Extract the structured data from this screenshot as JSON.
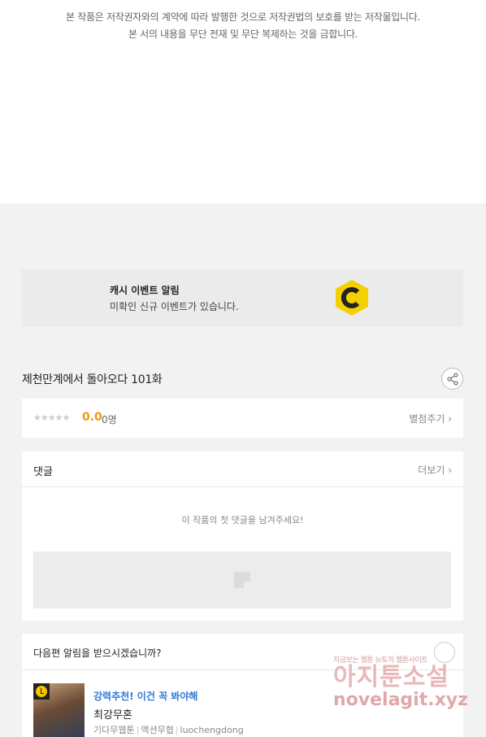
{
  "notice": {
    "line1": "본 작품은 저작권자와의 계약에 따라 발행한 것으로 저작권법의 보호를 받는 저작물입니다.",
    "line2": "본 서의 내용을 무단 전재 및 무단 복제하는 것을 금합니다."
  },
  "event": {
    "title": "캐시 이벤트 알림",
    "subtitle": "미확인 신규 이벤트가 있습니다.",
    "icon": "cash-c-icon",
    "icon_color": "#f5d000"
  },
  "episode": {
    "title": "제천만계에서 돌아오다 101화",
    "share_icon": "share-icon"
  },
  "rating": {
    "stars": "★★★★★",
    "score": "0.0",
    "count": "0명",
    "rate_link": "별점주기 ›"
  },
  "comments": {
    "title": "댓글",
    "more_link": "더보기 ›",
    "empty_message": "이 작품의 첫 댓글을 남겨주세요!"
  },
  "next_alert": {
    "title": "다음편 알림을 받으시겠습니까?",
    "bell_icon": "bell-icon"
  },
  "recommendation": {
    "tagline": "강력추천! 이건 꼭 봐야해",
    "title": "최강무혼",
    "meta": [
      "기다무웹툰",
      "액션무협",
      "luochengdong"
    ]
  },
  "watermark": {
    "top": "지금보는 웹툰 뉴토끼 웹툰사이트",
    "main": "아지툰소설",
    "url": "novelagit.xyz"
  }
}
